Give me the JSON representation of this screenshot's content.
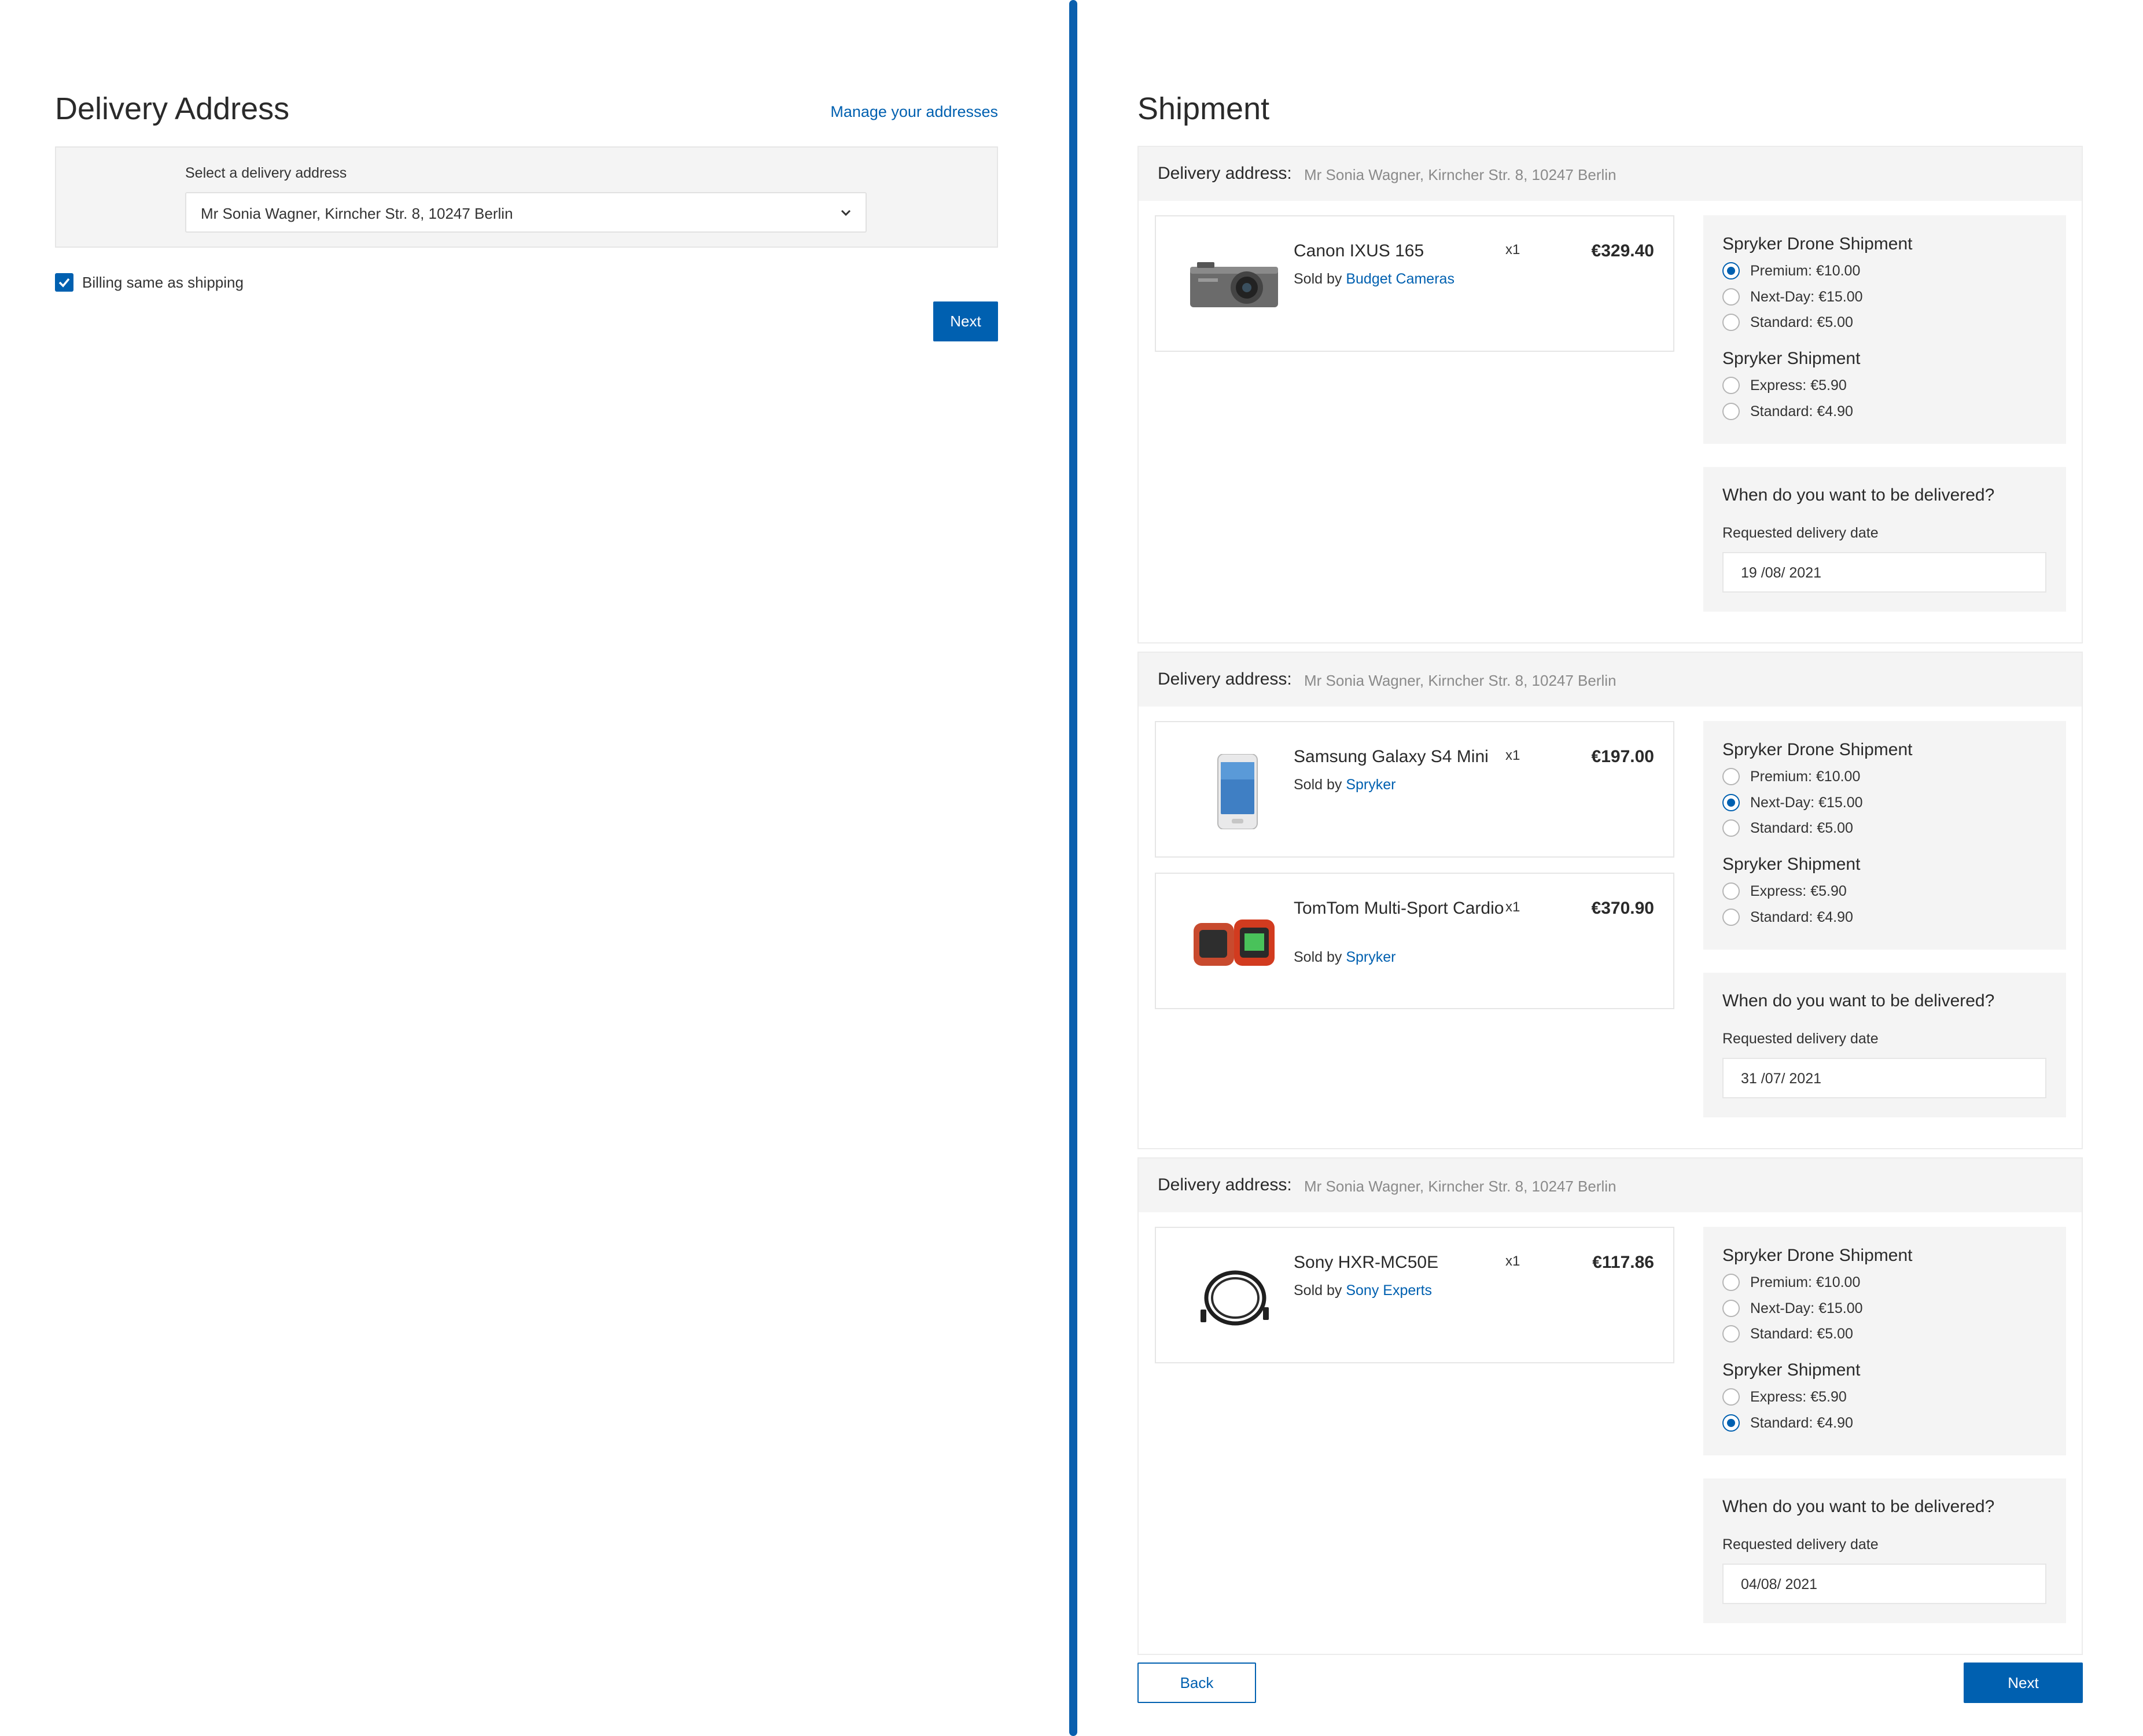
{
  "delivery": {
    "title": "Delivery Address",
    "manage_link": "Manage your addresses",
    "select_label": "Select a delivery address",
    "selected_address": "Mr Sonia Wagner, Kirncher Str. 8, 10247 Berlin",
    "billing_label": "Billing same as shipping",
    "billing_checked": true,
    "next_label": "Next"
  },
  "shipment": {
    "title": "Shipment",
    "groups": [
      {
        "address_label": "Delivery address:",
        "address_value": "Mr Sonia Wagner, Kirncher Str. 8, 10247 Berlin",
        "items": [
          {
            "name": "Canon IXUS 165",
            "qty": "x1",
            "price": "€329.40",
            "sold_by_prefix": "Sold by",
            "vendor": "Budget Cameras",
            "icon": "camera-image"
          }
        ],
        "methods": [
          {
            "title": "Spryker Drone Shipment",
            "options": [
              {
                "label": "Premium: €10.00",
                "checked": true
              },
              {
                "label": "Next-Day: €15.00",
                "checked": false
              },
              {
                "label": "Standard: €5.00",
                "checked": false
              }
            ]
          },
          {
            "title": "Spryker Shipment",
            "options": [
              {
                "label": "Express: €5.90",
                "checked": false
              },
              {
                "label": "Standard: €4.90",
                "checked": false
              }
            ]
          }
        ],
        "date_question": "When do you want to be delivered?",
        "date_label": "Requested delivery date",
        "date_value": "19 /08/ 2021"
      },
      {
        "address_label": "Delivery address:",
        "address_value": "Mr Sonia Wagner, Kirncher Str. 8, 10247 Berlin",
        "items": [
          {
            "name": "Samsung Galaxy S4 Mini",
            "qty": "x1",
            "price": "€197.00",
            "sold_by_prefix": "Sold by",
            "vendor": "Spryker",
            "icon": "smartphone-image"
          },
          {
            "name": "TomTom Multi-Sport Cardio",
            "qty": "x1",
            "price": "€370.90",
            "sold_by_prefix": "Sold by",
            "vendor": "Spryker",
            "icon": "sport-watch-image"
          }
        ],
        "methods": [
          {
            "title": "Spryker Drone Shipment",
            "options": [
              {
                "label": "Premium: €10.00",
                "checked": false
              },
              {
                "label": "Next-Day: €15.00",
                "checked": true
              },
              {
                "label": "Standard: €5.00",
                "checked": false
              }
            ]
          },
          {
            "title": "Spryker Shipment",
            "options": [
              {
                "label": "Express: €5.90",
                "checked": false
              },
              {
                "label": "Standard: €4.90",
                "checked": false
              }
            ]
          }
        ],
        "date_question": "When do you want to be delivered?",
        "date_label": "Requested delivery date",
        "date_value": "31 /07/ 2021"
      },
      {
        "address_label": "Delivery address:",
        "address_value": "Mr Sonia Wagner, Kirncher Str. 8, 10247 Berlin",
        "items": [
          {
            "name": "Sony HXR-MC50E",
            "qty": "x1",
            "price": "€117.86",
            "sold_by_prefix": "Sold by",
            "vendor": "Sony Experts",
            "icon": "cable-image"
          }
        ],
        "methods": [
          {
            "title": "Spryker Drone Shipment",
            "options": [
              {
                "label": "Premium: €10.00",
                "checked": false
              },
              {
                "label": "Next-Day: €15.00",
                "checked": false
              },
              {
                "label": "Standard: €5.00",
                "checked": false
              }
            ]
          },
          {
            "title": "Spryker Shipment",
            "options": [
              {
                "label": "Express: €5.90",
                "checked": false
              },
              {
                "label": "Standard: €4.90",
                "checked": true
              }
            ]
          }
        ],
        "date_question": "When do you want to be delivered?",
        "date_label": "Requested delivery date",
        "date_value": "04/08/ 2021"
      }
    ],
    "back_label": "Back",
    "next_label": "Next"
  },
  "colors": {
    "accent": "#0060b0",
    "panel_bg": "#f4f4f4",
    "divider": "#0a5fae"
  }
}
